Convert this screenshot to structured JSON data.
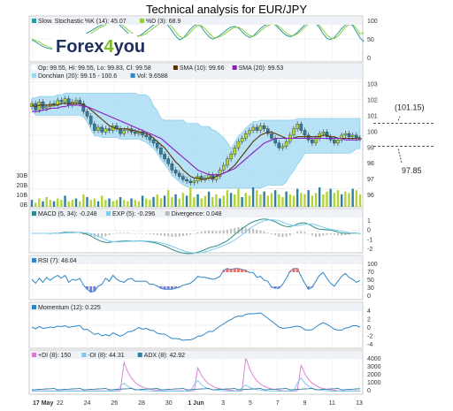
{
  "title": "Technical analysis for EUR/JPY",
  "logo": {
    "part1": "Forex",
    "part2": "4",
    "part3": "you"
  },
  "colors": {
    "up": "#b4d334",
    "down": "#2d7fa0",
    "band": "#9fd8f3",
    "sma10": "#5a3200",
    "sma20": "#8a1cc0",
    "macd": "#2a8c8a",
    "exp": "#80c9ef",
    "stoch": "#2b9aa0",
    "ema": "#8ecf3d",
    "rsi": "#2d85c5",
    "mom": "#2d85c5",
    "pdi": "#d877d2",
    "mdi": "#7ec4f0",
    "adx": "#2d7fa0"
  },
  "chart_data": [
    {
      "type": "line",
      "panel": "stochastic",
      "legend": [
        "Slow. Stochastic %K (14): 45.07",
        "%D (3): 68.9"
      ],
      "yticks": [
        "100",
        "50",
        "0"
      ],
      "series": [
        {
          "name": "%K",
          "values": [
            50,
            44,
            38,
            32,
            28,
            26,
            24,
            24,
            26,
            30,
            36,
            42,
            48,
            54,
            60,
            68,
            74,
            80,
            86,
            90,
            94,
            96,
            100,
            96,
            88,
            78,
            68,
            62,
            58,
            60,
            66,
            74,
            82,
            90,
            96,
            100,
            98,
            88,
            74,
            60,
            50,
            54,
            66,
            78,
            88,
            92,
            84,
            70,
            58,
            52,
            56,
            62,
            70,
            78,
            84,
            86,
            82,
            72,
            62,
            56,
            60,
            70,
            80,
            88,
            92,
            94,
            90,
            80,
            70,
            62,
            58,
            62,
            70,
            80,
            90,
            96,
            98,
            94,
            82,
            66,
            54,
            50,
            56,
            68,
            80,
            90,
            94,
            88,
            72,
            55,
            45
          ]
        },
        {
          "name": "%D",
          "values": [
            52,
            48,
            44,
            38,
            33,
            29,
            27,
            26,
            25,
            27,
            31,
            36,
            42,
            48,
            54,
            61,
            67,
            74,
            80,
            85,
            90,
            93,
            97,
            97,
            93,
            86,
            77,
            69,
            63,
            60,
            62,
            67,
            74,
            82,
            89,
            95,
            98,
            95,
            85,
            72,
            60,
            55,
            60,
            70,
            81,
            89,
            88,
            80,
            68,
            58,
            55,
            58,
            64,
            71,
            78,
            83,
            84,
            79,
            70,
            62,
            59,
            64,
            73,
            82,
            88,
            92,
            92,
            86,
            77,
            68,
            62,
            61,
            66,
            74,
            84,
            92,
            96,
            96,
            88,
            76,
            63,
            55,
            53,
            60,
            72,
            84,
            91,
            91,
            81,
            66,
            68.9
          ]
        }
      ]
    },
    {
      "type": "candlestick",
      "panel": "price",
      "legend": [
        "Op: 99.55, Hi: 99.55, Lo: 99.83, Cl: 99.58",
        "SMA (10): 99.66",
        "SMA (20): 99.53",
        "Donchian (20): 99.15 - 100.6",
        "Vol: 9.6588"
      ],
      "yticks": [
        "103",
        "102",
        "101",
        "100",
        "99",
        "98",
        "97",
        "96"
      ],
      "vol_ticks": [
        "30B",
        "20B",
        "10B",
        "0B"
      ],
      "x_labels": [
        "17 May",
        "22",
        "24",
        "26",
        "28",
        "30",
        "1 Jun",
        "3",
        "5",
        "7",
        "9",
        "11",
        "13"
      ],
      "ylim": [
        95.5,
        103.2
      ],
      "close": [
        101.8,
        101.4,
        101.9,
        101.5,
        101.6,
        101.8,
        101.7,
        102.0,
        101.9,
        102.1,
        101.7,
        101.9,
        102.0,
        101.8,
        101.3,
        101.0,
        100.5,
        100.1,
        100.3,
        100.0,
        100.2,
        100.1,
        100.4,
        100.2,
        99.9,
        100.1,
        100.2,
        100.0,
        99.9,
        100.0,
        99.8,
        99.7,
        99.5,
        99.3,
        99.0,
        98.6,
        98.3,
        98.0,
        97.6,
        97.4,
        97.2,
        97.0,
        96.9,
        96.8,
        96.9,
        97.2,
        97.0,
        97.1,
        97.3,
        97.0,
        97.2,
        97.6,
        97.9,
        98.3,
        98.6,
        99.0,
        99.4,
        99.6,
        99.9,
        100.1,
        100.3,
        100.1,
        100.4,
        100.2,
        99.9,
        99.6,
        99.3,
        99.0,
        99.1,
        99.4,
        99.8,
        100.2,
        100.5,
        100.1,
        99.8,
        99.5,
        99.3,
        99.6,
        99.9,
        100.0,
        99.7,
        99.5,
        99.3,
        99.5,
        99.8,
        99.9,
        99.7,
        99.8,
        99.6,
        99.58
      ],
      "series": [
        {
          "name": "SMA (10)",
          "values": [
            101.7,
            101.6,
            101.7,
            101.7,
            101.7,
            101.7,
            101.7,
            101.7,
            101.8,
            101.8,
            101.8,
            101.8,
            101.8,
            101.8,
            101.7,
            101.6,
            101.4,
            101.2,
            101.0,
            100.8,
            100.6,
            100.4,
            100.3,
            100.2,
            100.2,
            100.2,
            100.2,
            100.1,
            100.1,
            100.0,
            100.0,
            99.9,
            99.8,
            99.6,
            99.4,
            99.2,
            99.0,
            98.7,
            98.4,
            98.1,
            97.9,
            97.6,
            97.4,
            97.2,
            97.1,
            97.1,
            97.0,
            97.0,
            97.1,
            97.1,
            97.2,
            97.3,
            97.4,
            97.5,
            97.7,
            97.9,
            98.2,
            98.5,
            98.8,
            99.1,
            99.4,
            99.6,
            99.8,
            99.9,
            100.0,
            100.0,
            99.9,
            99.8,
            99.7,
            99.6,
            99.6,
            99.6,
            99.7,
            99.7,
            99.7,
            99.7,
            99.7,
            99.7,
            99.7,
            99.8,
            99.8,
            99.7,
            99.7,
            99.6,
            99.6,
            99.6,
            99.6,
            99.6,
            99.6,
            99.66
          ]
        },
        {
          "name": "SMA (20)",
          "values": [
            101.3,
            101.3,
            101.3,
            101.4,
            101.4,
            101.5,
            101.5,
            101.5,
            101.6,
            101.6,
            101.7,
            101.7,
            101.7,
            101.7,
            101.6,
            101.6,
            101.5,
            101.4,
            101.3,
            101.2,
            101.1,
            101.0,
            100.9,
            100.8,
            100.7,
            100.6,
            100.5,
            100.4,
            100.3,
            100.2,
            100.1,
            100.0,
            99.9,
            99.8,
            99.7,
            99.6,
            99.4,
            99.2,
            99.0,
            98.8,
            98.6,
            98.4,
            98.2,
            98.0,
            97.8,
            97.6,
            97.5,
            97.4,
            97.3,
            97.3,
            97.3,
            97.3,
            97.4,
            97.5,
            97.6,
            97.7,
            97.9,
            98.1,
            98.3,
            98.5,
            98.7,
            98.9,
            99.1,
            99.3,
            99.4,
            99.5,
            99.6,
            99.6,
            99.6,
            99.6,
            99.6,
            99.6,
            99.6,
            99.6,
            99.6,
            99.6,
            99.6,
            99.6,
            99.6,
            99.6,
            99.6,
            99.6,
            99.6,
            99.6,
            99.6,
            99.5,
            99.5,
            99.5,
            99.5,
            99.53
          ]
        }
      ],
      "volume": [
        5,
        3,
        6,
        4,
        7,
        5,
        4,
        6,
        5,
        8,
        4,
        5,
        6,
        4,
        9,
        7,
        5,
        6,
        4,
        8,
        5,
        6,
        4,
        5,
        7,
        5,
        4,
        6,
        5,
        4,
        8,
        6,
        5,
        7,
        9,
        6,
        8,
        12,
        7,
        9,
        6,
        10,
        8,
        14,
        7,
        9,
        6,
        8,
        11,
        7,
        9,
        6,
        8,
        12,
        10,
        9,
        13,
        7,
        10,
        8,
        14,
        12,
        9,
        11,
        8,
        10,
        12,
        9,
        7,
        11,
        9,
        8,
        13,
        10,
        9,
        12,
        8,
        10,
        14,
        9,
        11,
        13,
        10,
        12,
        9,
        11,
        10,
        13,
        12,
        9
      ],
      "annotations": [
        "(101.15)",
        "97.85"
      ]
    },
    {
      "type": "line",
      "panel": "macd",
      "legend": [
        "MACD (5, 34): -0.248",
        "EXP (5): -0.296",
        "Divergence: 0.048"
      ],
      "yticks": [
        "1",
        "0",
        "-1",
        "-2"
      ]
    },
    {
      "type": "line",
      "panel": "rsi",
      "legend": [
        "RSI (7): 48.04"
      ],
      "yticks": [
        "100",
        "70",
        "50",
        "30",
        "0"
      ]
    },
    {
      "type": "line",
      "panel": "momentum",
      "legend": [
        "Momentum (12): 0.225"
      ],
      "yticks": [
        "4",
        "2",
        "0",
        "-2",
        "-4"
      ]
    },
    {
      "type": "line",
      "panel": "adx",
      "legend": [
        "+DI (8): 150",
        "-DI (8): 44.31",
        "ADX (8): 42.92"
      ],
      "yticks": [
        "4000",
        "3000",
        "2000",
        "1000",
        "0"
      ]
    }
  ]
}
